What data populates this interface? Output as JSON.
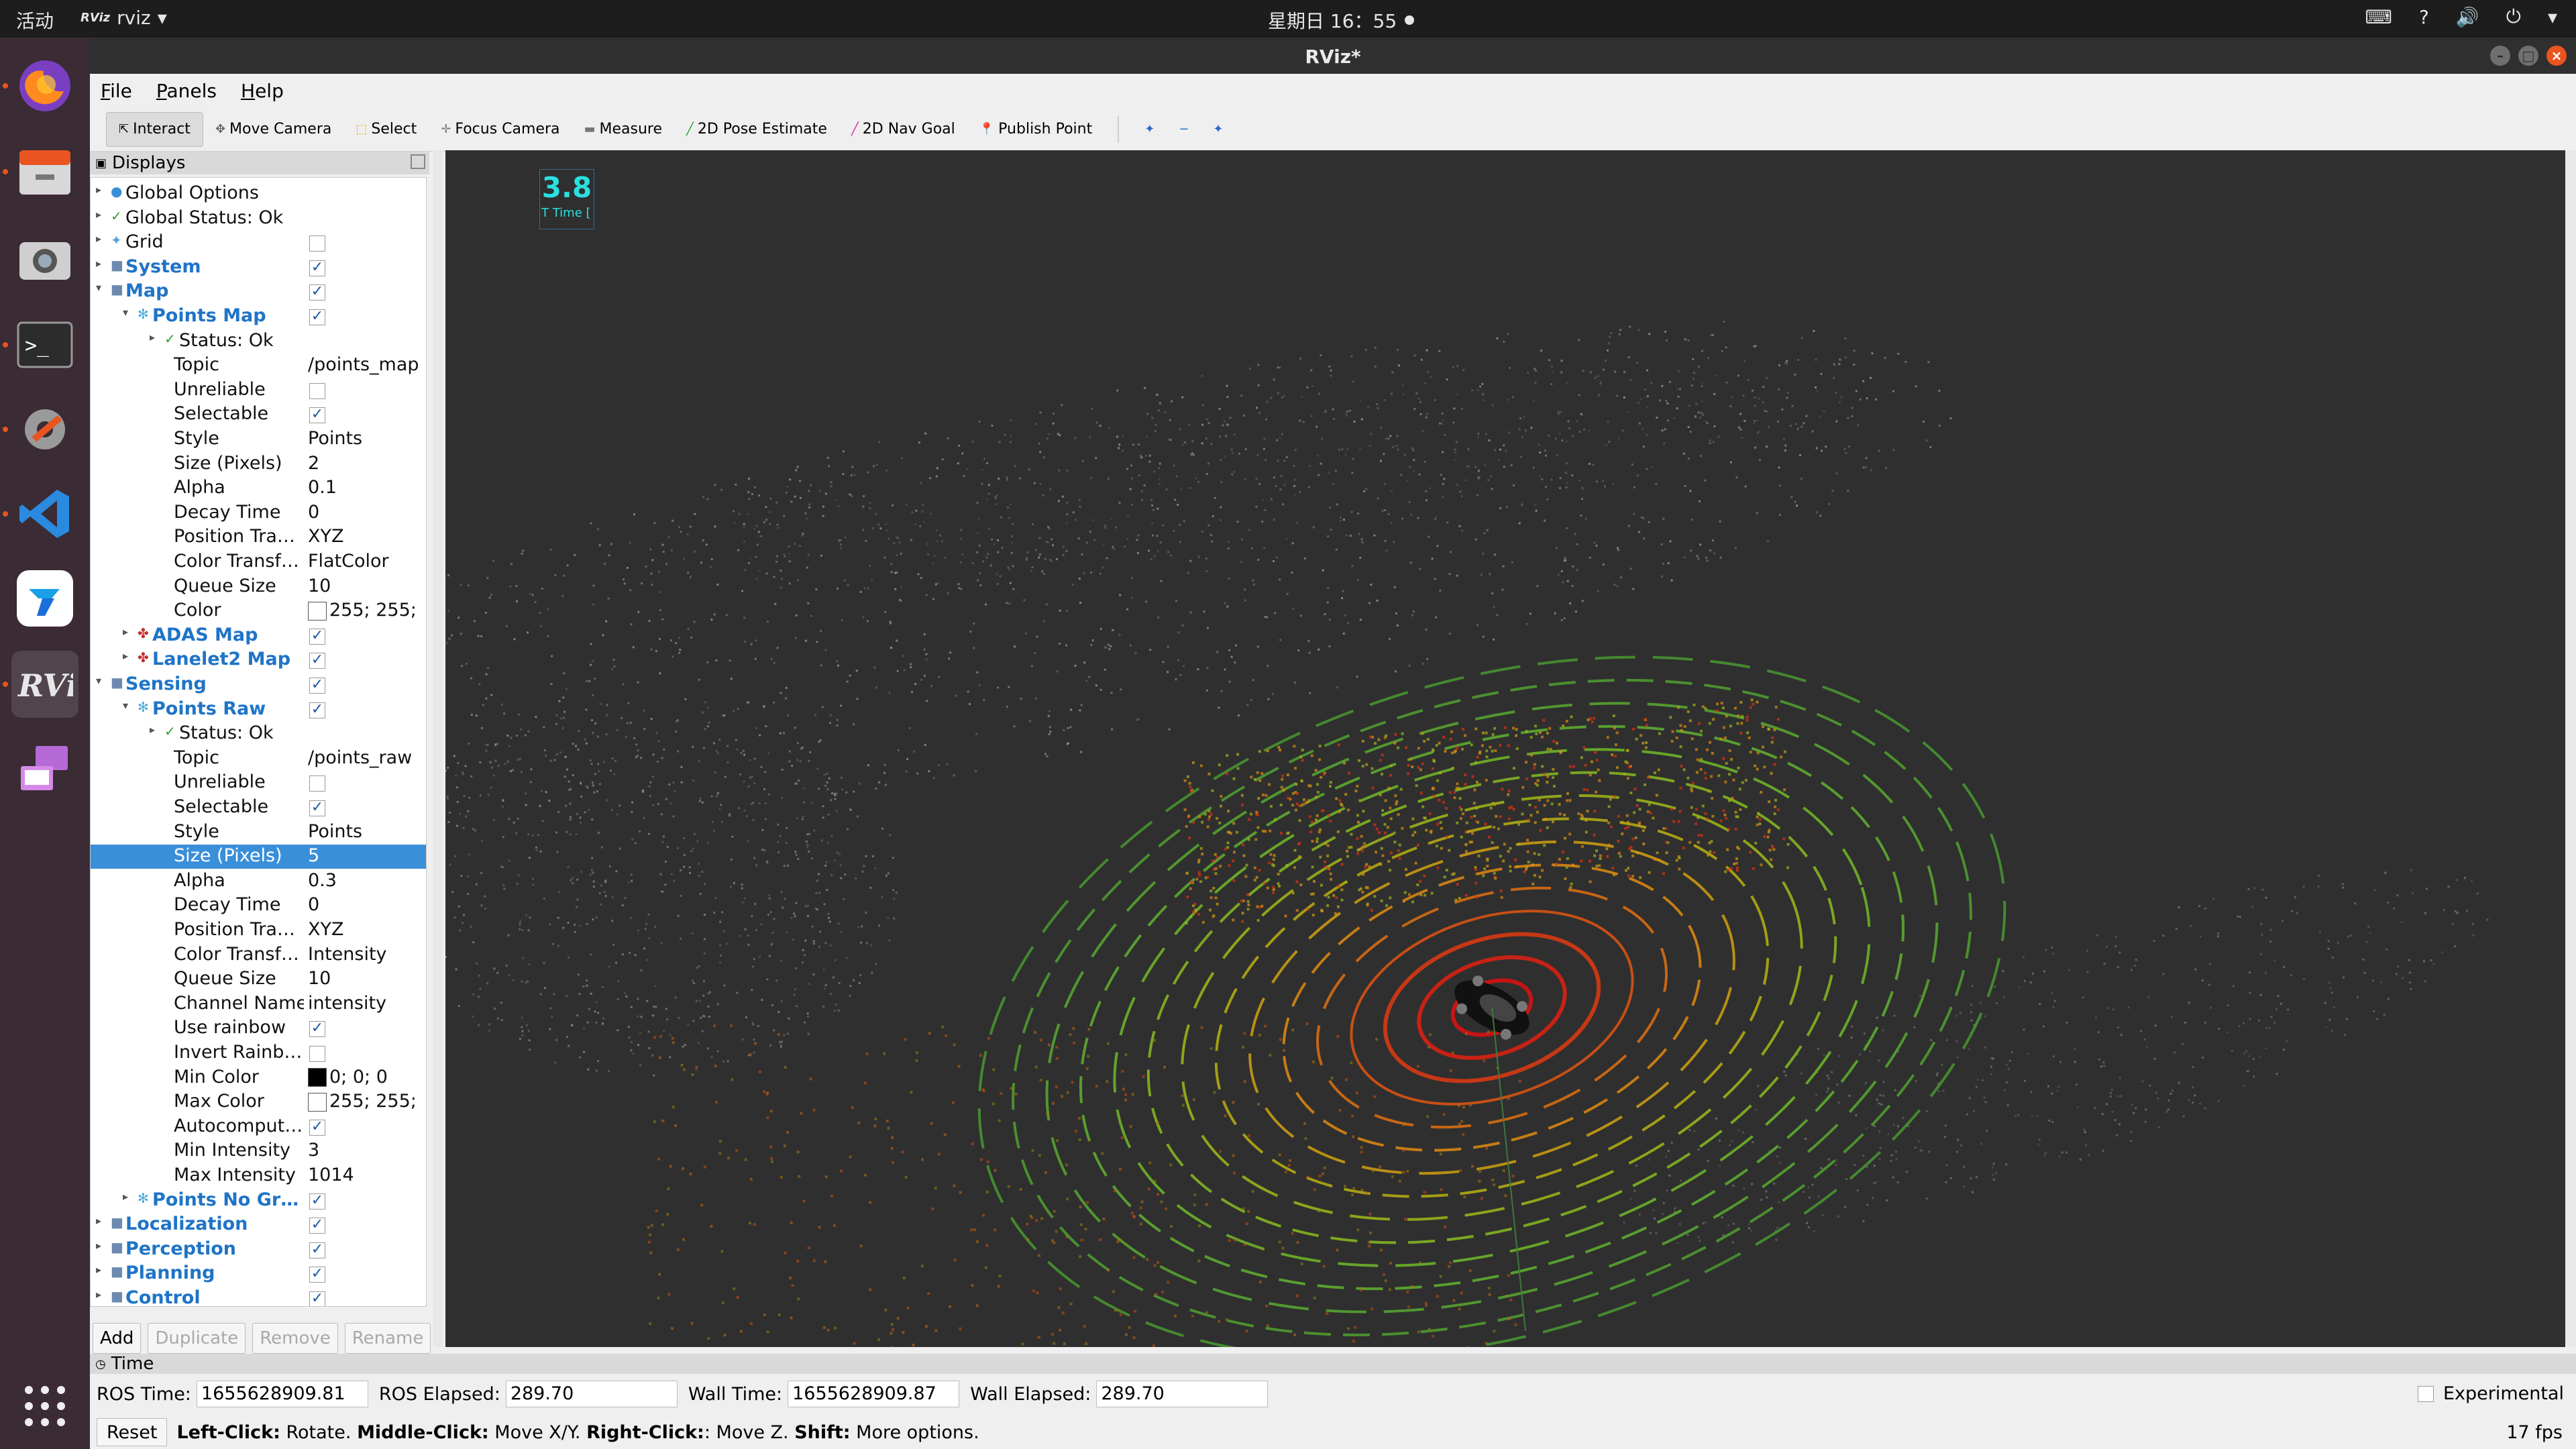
{
  "topbar": {
    "activities": "活动",
    "app_logo": "RViz",
    "app_name": "rviz",
    "clock": "星期日 16：55",
    "tray_icons": [
      "keyboard-icon",
      "help-icon",
      "volume-icon",
      "power-icon",
      "chevron-down-icon"
    ]
  },
  "dock": {
    "items": [
      "firefox",
      "files",
      "screenshot",
      "terminal",
      "settings",
      "vscode",
      "feishu",
      "rviz",
      "remote-desktop",
      "show-applications"
    ]
  },
  "window": {
    "title": "RViz*"
  },
  "menubar": {
    "file": "File",
    "panels": "Panels",
    "help": "Help"
  },
  "toolbar": {
    "interact": "Interact",
    "move_camera": "Move Camera",
    "select": "Select",
    "focus_camera": "Focus Camera",
    "measure": "Measure",
    "pose_estimate": "2D Pose Estimate",
    "nav_goal": "2D Nav Goal",
    "publish_point": "Publish Point"
  },
  "displays": {
    "title": "Displays",
    "rows": [
      {
        "label": "Global Options",
        "value": ""
      },
      {
        "label": "Global Status: Ok",
        "value": ""
      },
      {
        "label": "Grid",
        "value": ""
      },
      {
        "label": "System",
        "value": ""
      },
      {
        "label": "Map",
        "value": ""
      },
      {
        "label": "Points Map",
        "value": ""
      },
      {
        "label": "Status: Ok",
        "value": ""
      },
      {
        "label": "Topic",
        "value": "/points_map"
      },
      {
        "label": "Unreliable",
        "value": ""
      },
      {
        "label": "Selectable",
        "value": ""
      },
      {
        "label": "Style",
        "value": "Points"
      },
      {
        "label": "Size (Pixels)",
        "value": "2"
      },
      {
        "label": "Alpha",
        "value": "0.1"
      },
      {
        "label": "Decay Time",
        "value": "0"
      },
      {
        "label": "Position Tra…",
        "value": "XYZ"
      },
      {
        "label": "Color Transf…",
        "value": "FlatColor"
      },
      {
        "label": "Queue Size",
        "value": "10"
      },
      {
        "label": "Color",
        "value": "255; 255;"
      },
      {
        "label": "ADAS Map",
        "value": ""
      },
      {
        "label": "Lanelet2 Map",
        "value": ""
      },
      {
        "label": "Sensing",
        "value": ""
      },
      {
        "label": "Points Raw",
        "value": ""
      },
      {
        "label": "Status: Ok",
        "value": ""
      },
      {
        "label": "Topic",
        "value": "/points_raw"
      },
      {
        "label": "Unreliable",
        "value": ""
      },
      {
        "label": "Selectable",
        "value": ""
      },
      {
        "label": "Style",
        "value": "Points"
      },
      {
        "label": "Size (Pixels)",
        "value": "5"
      },
      {
        "label": "Alpha",
        "value": "0.3"
      },
      {
        "label": "Decay Time",
        "value": "0"
      },
      {
        "label": "Position Tra…",
        "value": "XYZ"
      },
      {
        "label": "Color Transf…",
        "value": "Intensity"
      },
      {
        "label": "Queue Size",
        "value": "10"
      },
      {
        "label": "Channel Name",
        "value": "intensity"
      },
      {
        "label": "Use rainbow",
        "value": ""
      },
      {
        "label": "Invert Rainb…",
        "value": ""
      },
      {
        "label": "Min Color",
        "value": "0; 0; 0"
      },
      {
        "label": "Max Color",
        "value": "255; 255;"
      },
      {
        "label": "Autocomput…",
        "value": ""
      },
      {
        "label": "Min Intensity",
        "value": "3"
      },
      {
        "label": "Max Intensity",
        "value": "1014"
      },
      {
        "label": "Points No Gr…",
        "value": ""
      },
      {
        "label": "Localization",
        "value": ""
      },
      {
        "label": "Perception",
        "value": ""
      },
      {
        "label": "Planning",
        "value": ""
      },
      {
        "label": "Control",
        "value": ""
      }
    ],
    "buttons": {
      "add": "Add",
      "duplicate": "Duplicate",
      "remove": "Remove",
      "rename": "Rename"
    }
  },
  "viewport": {
    "overlay_value": "3.8",
    "overlay_caption": "T Time ["
  },
  "time": {
    "title": "Time",
    "ros_time_label": "ROS Time:",
    "ros_time": "1655628909.81",
    "ros_elapsed_label": "ROS Elapsed:",
    "ros_elapsed": "289.70",
    "wall_time_label": "Wall Time:",
    "wall_time": "1655628909.87",
    "wall_elapsed_label": "Wall Elapsed:",
    "wall_elapsed": "289.70",
    "experimental": "Experimental"
  },
  "status": {
    "reset": "Reset",
    "left_click": "Left-Click:",
    "left_action": " Rotate. ",
    "middle_click": "Middle-Click:",
    "middle_action": " Move X/Y. ",
    "right_click": "Right-Click:",
    "right_action": ": Move Z. ",
    "shift": "Shift:",
    "shift_action": " More options.",
    "fps": "17 fps"
  }
}
